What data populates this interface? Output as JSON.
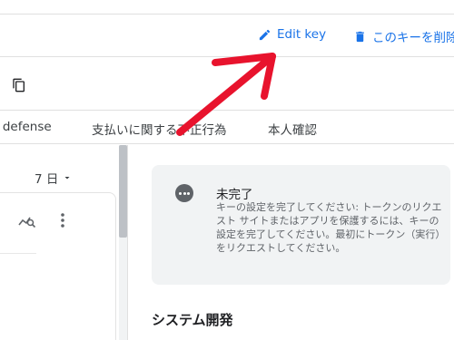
{
  "header": {
    "edit_label": "Edit key",
    "delete_label": "このキーを削除"
  },
  "tabs": [
    {
      "label": "S defense"
    },
    {
      "label": "支払いに関する不正行為"
    },
    {
      "label": "本人確認"
    }
  ],
  "range": {
    "label": "7 日"
  },
  "notice": {
    "title": "未完了",
    "body": "キーの設定を完了してください: トークンのリクエスト サイトまたはアプリを保護するには、キーの設定を完了してください。最初にトークン（実行）をリクエストしてください。"
  },
  "section": {
    "title": "システム開発"
  },
  "colors": {
    "accent": "#1a73e8",
    "arrow": "#e8132d",
    "notice_bg": "#f1f3f4"
  },
  "icons": [
    "pencil-icon",
    "trash-icon",
    "copy-icon",
    "dropdown-arrow-icon",
    "chart-search-icon",
    "more-vert-icon",
    "more-horiz-icon",
    "annotation-arrow"
  ]
}
